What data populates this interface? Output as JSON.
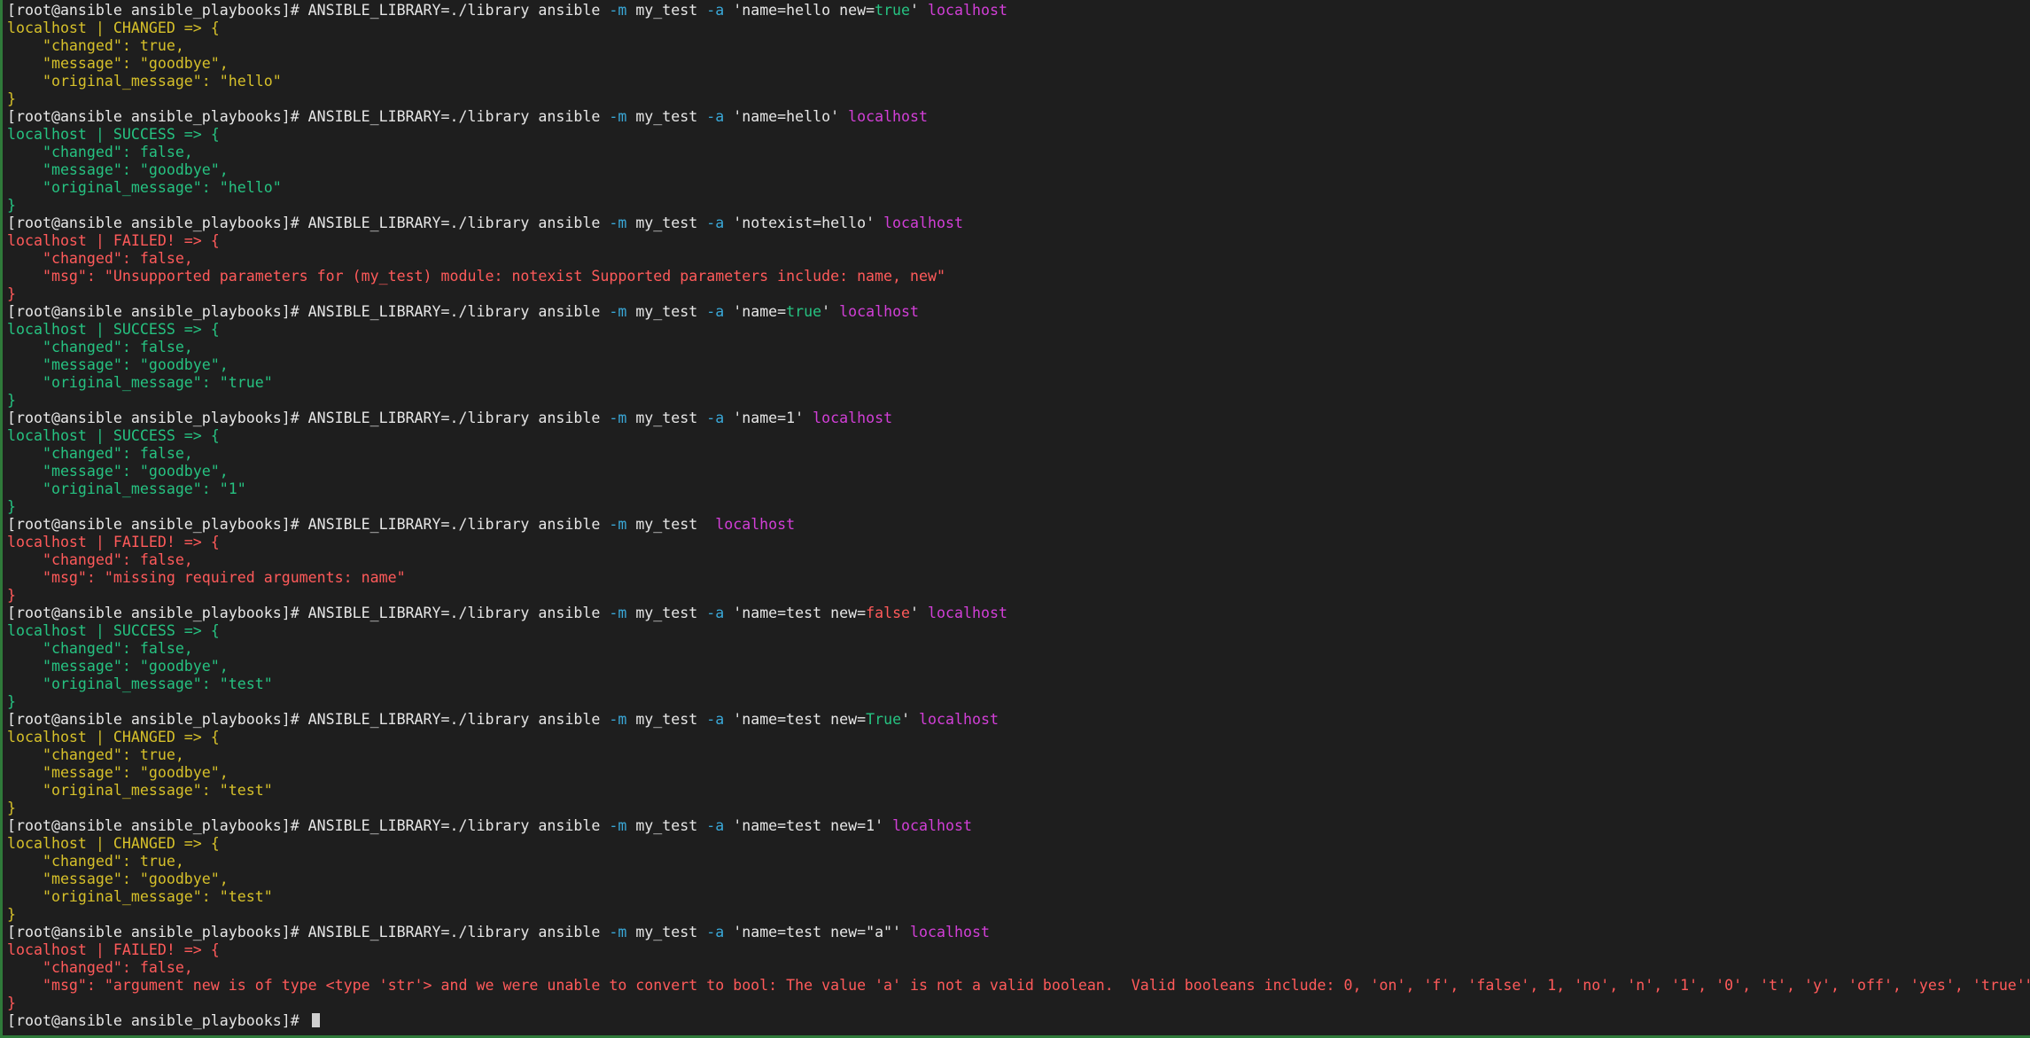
{
  "window": {
    "type": "terminal",
    "colors": {
      "background": "#1e1e1e",
      "text": "#e6e6e6",
      "option": "#3aa8d8",
      "bool_true": "#26c281",
      "bool_false": "#ff5a5a",
      "host": "#d23fd7",
      "changed": "#d6c02a",
      "success": "#26c281",
      "failed": "#ff5a5a"
    }
  },
  "lines": [
    {
      "segments": [
        {
          "t": "[root@ansible ansible_playbooks]# ANSIBLE_LIBRARY=./library ansible ",
          "c": "white"
        },
        {
          "t": "-m",
          "c": "blue"
        },
        {
          "t": " my_test ",
          "c": "white"
        },
        {
          "t": "-a",
          "c": "blue"
        },
        {
          "t": " 'name=hello new=",
          "c": "white"
        },
        {
          "t": "true",
          "c": "green"
        },
        {
          "t": "' ",
          "c": "white"
        },
        {
          "t": "localhost",
          "c": "magenta"
        }
      ]
    },
    {
      "segments": [
        {
          "t": "localhost | CHANGED => {",
          "c": "yellow"
        }
      ]
    },
    {
      "segments": [
        {
          "t": "    \"changed\": true,",
          "c": "yellow"
        }
      ]
    },
    {
      "segments": [
        {
          "t": "    \"message\": \"goodbye\",",
          "c": "yellow"
        }
      ]
    },
    {
      "segments": [
        {
          "t": "    \"original_message\": \"hello\"",
          "c": "yellow"
        }
      ]
    },
    {
      "segments": [
        {
          "t": "}",
          "c": "yellow"
        }
      ]
    },
    {
      "segments": [
        {
          "t": "[root@ansible ansible_playbooks]# ANSIBLE_LIBRARY=./library ansible ",
          "c": "white"
        },
        {
          "t": "-m",
          "c": "blue"
        },
        {
          "t": " my_test ",
          "c": "white"
        },
        {
          "t": "-a",
          "c": "blue"
        },
        {
          "t": " 'name=hello' ",
          "c": "white"
        },
        {
          "t": "localhost",
          "c": "magenta"
        }
      ]
    },
    {
      "segments": [
        {
          "t": "localhost | SUCCESS => {",
          "c": "green"
        }
      ]
    },
    {
      "segments": [
        {
          "t": "    \"changed\": false,",
          "c": "green"
        }
      ]
    },
    {
      "segments": [
        {
          "t": "    \"message\": \"goodbye\",",
          "c": "green"
        }
      ]
    },
    {
      "segments": [
        {
          "t": "    \"original_message\": \"hello\"",
          "c": "green"
        }
      ]
    },
    {
      "segments": [
        {
          "t": "}",
          "c": "green"
        }
      ]
    },
    {
      "segments": [
        {
          "t": "[root@ansible ansible_playbooks]# ANSIBLE_LIBRARY=./library ansible ",
          "c": "white"
        },
        {
          "t": "-m",
          "c": "blue"
        },
        {
          "t": " my_test ",
          "c": "white"
        },
        {
          "t": "-a",
          "c": "blue"
        },
        {
          "t": " 'notexist=hello' ",
          "c": "white"
        },
        {
          "t": "localhost",
          "c": "magenta"
        }
      ]
    },
    {
      "segments": [
        {
          "t": "localhost | FAILED! => {",
          "c": "red"
        }
      ]
    },
    {
      "segments": [
        {
          "t": "    \"changed\": false,",
          "c": "red"
        }
      ]
    },
    {
      "segments": [
        {
          "t": "    \"msg\": \"Unsupported parameters for (my_test) module: notexist Supported parameters include: name, new\"",
          "c": "red"
        }
      ]
    },
    {
      "segments": [
        {
          "t": "}",
          "c": "red"
        }
      ]
    },
    {
      "segments": [
        {
          "t": "[root@ansible ansible_playbooks]# ANSIBLE_LIBRARY=./library ansible ",
          "c": "white"
        },
        {
          "t": "-m",
          "c": "blue"
        },
        {
          "t": " my_test ",
          "c": "white"
        },
        {
          "t": "-a",
          "c": "blue"
        },
        {
          "t": " 'name=",
          "c": "white"
        },
        {
          "t": "true",
          "c": "green"
        },
        {
          "t": "' ",
          "c": "white"
        },
        {
          "t": "localhost",
          "c": "magenta"
        }
      ]
    },
    {
      "segments": [
        {
          "t": "localhost | SUCCESS => {",
          "c": "green"
        }
      ]
    },
    {
      "segments": [
        {
          "t": "    \"changed\": false,",
          "c": "green"
        }
      ]
    },
    {
      "segments": [
        {
          "t": "    \"message\": \"goodbye\",",
          "c": "green"
        }
      ]
    },
    {
      "segments": [
        {
          "t": "    \"original_message\": \"true\"",
          "c": "green"
        }
      ]
    },
    {
      "segments": [
        {
          "t": "}",
          "c": "green"
        }
      ]
    },
    {
      "segments": [
        {
          "t": "[root@ansible ansible_playbooks]# ANSIBLE_LIBRARY=./library ansible ",
          "c": "white"
        },
        {
          "t": "-m",
          "c": "blue"
        },
        {
          "t": " my_test ",
          "c": "white"
        },
        {
          "t": "-a",
          "c": "blue"
        },
        {
          "t": " 'name=1' ",
          "c": "white"
        },
        {
          "t": "localhost",
          "c": "magenta"
        }
      ]
    },
    {
      "segments": [
        {
          "t": "localhost | SUCCESS => {",
          "c": "green"
        }
      ]
    },
    {
      "segments": [
        {
          "t": "    \"changed\": false,",
          "c": "green"
        }
      ]
    },
    {
      "segments": [
        {
          "t": "    \"message\": \"goodbye\",",
          "c": "green"
        }
      ]
    },
    {
      "segments": [
        {
          "t": "    \"original_message\": \"1\"",
          "c": "green"
        }
      ]
    },
    {
      "segments": [
        {
          "t": "}",
          "c": "green"
        }
      ]
    },
    {
      "segments": [
        {
          "t": "[root@ansible ansible_playbooks]# ANSIBLE_LIBRARY=./library ansible ",
          "c": "white"
        },
        {
          "t": "-m",
          "c": "blue"
        },
        {
          "t": " my_test  ",
          "c": "white"
        },
        {
          "t": "localhost",
          "c": "magenta"
        }
      ]
    },
    {
      "segments": [
        {
          "t": "localhost | FAILED! => {",
          "c": "red"
        }
      ]
    },
    {
      "segments": [
        {
          "t": "    \"changed\": false,",
          "c": "red"
        }
      ]
    },
    {
      "segments": [
        {
          "t": "    \"msg\": \"missing required arguments: name\"",
          "c": "red"
        }
      ]
    },
    {
      "segments": [
        {
          "t": "}",
          "c": "red"
        }
      ]
    },
    {
      "segments": [
        {
          "t": "[root@ansible ansible_playbooks]# ANSIBLE_LIBRARY=./library ansible ",
          "c": "white"
        },
        {
          "t": "-m",
          "c": "blue"
        },
        {
          "t": " my_test ",
          "c": "white"
        },
        {
          "t": "-a",
          "c": "blue"
        },
        {
          "t": " 'name=test new=",
          "c": "white"
        },
        {
          "t": "false",
          "c": "red"
        },
        {
          "t": "' ",
          "c": "white"
        },
        {
          "t": "localhost",
          "c": "magenta"
        }
      ]
    },
    {
      "segments": [
        {
          "t": "localhost | SUCCESS => {",
          "c": "green"
        }
      ]
    },
    {
      "segments": [
        {
          "t": "    \"changed\": false,",
          "c": "green"
        }
      ]
    },
    {
      "segments": [
        {
          "t": "    \"message\": \"goodbye\",",
          "c": "green"
        }
      ]
    },
    {
      "segments": [
        {
          "t": "    \"original_message\": \"test\"",
          "c": "green"
        }
      ]
    },
    {
      "segments": [
        {
          "t": "}",
          "c": "green"
        }
      ]
    },
    {
      "segments": [
        {
          "t": "[root@ansible ansible_playbooks]# ANSIBLE_LIBRARY=./library ansible ",
          "c": "white"
        },
        {
          "t": "-m",
          "c": "blue"
        },
        {
          "t": " my_test ",
          "c": "white"
        },
        {
          "t": "-a",
          "c": "blue"
        },
        {
          "t": " 'name=test new=",
          "c": "white"
        },
        {
          "t": "True",
          "c": "green"
        },
        {
          "t": "' ",
          "c": "white"
        },
        {
          "t": "localhost",
          "c": "magenta"
        }
      ]
    },
    {
      "segments": [
        {
          "t": "localhost | CHANGED => {",
          "c": "yellow"
        }
      ]
    },
    {
      "segments": [
        {
          "t": "    \"changed\": true,",
          "c": "yellow"
        }
      ]
    },
    {
      "segments": [
        {
          "t": "    \"message\": \"goodbye\",",
          "c": "yellow"
        }
      ]
    },
    {
      "segments": [
        {
          "t": "    \"original_message\": \"test\"",
          "c": "yellow"
        }
      ]
    },
    {
      "segments": [
        {
          "t": "}",
          "c": "yellow"
        }
      ]
    },
    {
      "segments": [
        {
          "t": "[root@ansible ansible_playbooks]# ANSIBLE_LIBRARY=./library ansible ",
          "c": "white"
        },
        {
          "t": "-m",
          "c": "blue"
        },
        {
          "t": " my_test ",
          "c": "white"
        },
        {
          "t": "-a",
          "c": "blue"
        },
        {
          "t": " 'name=test new=1' ",
          "c": "white"
        },
        {
          "t": "localhost",
          "c": "magenta"
        }
      ]
    },
    {
      "segments": [
        {
          "t": "localhost | CHANGED => {",
          "c": "yellow"
        }
      ]
    },
    {
      "segments": [
        {
          "t": "    \"changed\": true,",
          "c": "yellow"
        }
      ]
    },
    {
      "segments": [
        {
          "t": "    \"message\": \"goodbye\",",
          "c": "yellow"
        }
      ]
    },
    {
      "segments": [
        {
          "t": "    \"original_message\": \"test\"",
          "c": "yellow"
        }
      ]
    },
    {
      "segments": [
        {
          "t": "}",
          "c": "yellow"
        }
      ]
    },
    {
      "segments": [
        {
          "t": "[root@ansible ansible_playbooks]# ANSIBLE_LIBRARY=./library ansible ",
          "c": "white"
        },
        {
          "t": "-m",
          "c": "blue"
        },
        {
          "t": " my_test ",
          "c": "white"
        },
        {
          "t": "-a",
          "c": "blue"
        },
        {
          "t": " 'name=test new=\"a\"' ",
          "c": "white"
        },
        {
          "t": "localhost",
          "c": "magenta"
        }
      ]
    },
    {
      "segments": [
        {
          "t": "localhost | FAILED! => {",
          "c": "red"
        }
      ]
    },
    {
      "segments": [
        {
          "t": "    \"changed\": false,",
          "c": "red"
        }
      ]
    },
    {
      "segments": [
        {
          "t": "    \"msg\": \"argument new is of type <type 'str'> and we were unable to convert to bool: The value 'a' is not a valid boolean.  Valid booleans include: 0, 'on', 'f', 'false', 1, 'no', 'n', '1', '0', 't', 'y', 'off', 'yes', 'true'\"",
          "c": "red"
        }
      ]
    },
    {
      "segments": [
        {
          "t": "}",
          "c": "red"
        }
      ]
    }
  ],
  "prompt": {
    "text": "[root@ansible ansible_playbooks]# ",
    "cursor": "block-cursor"
  }
}
